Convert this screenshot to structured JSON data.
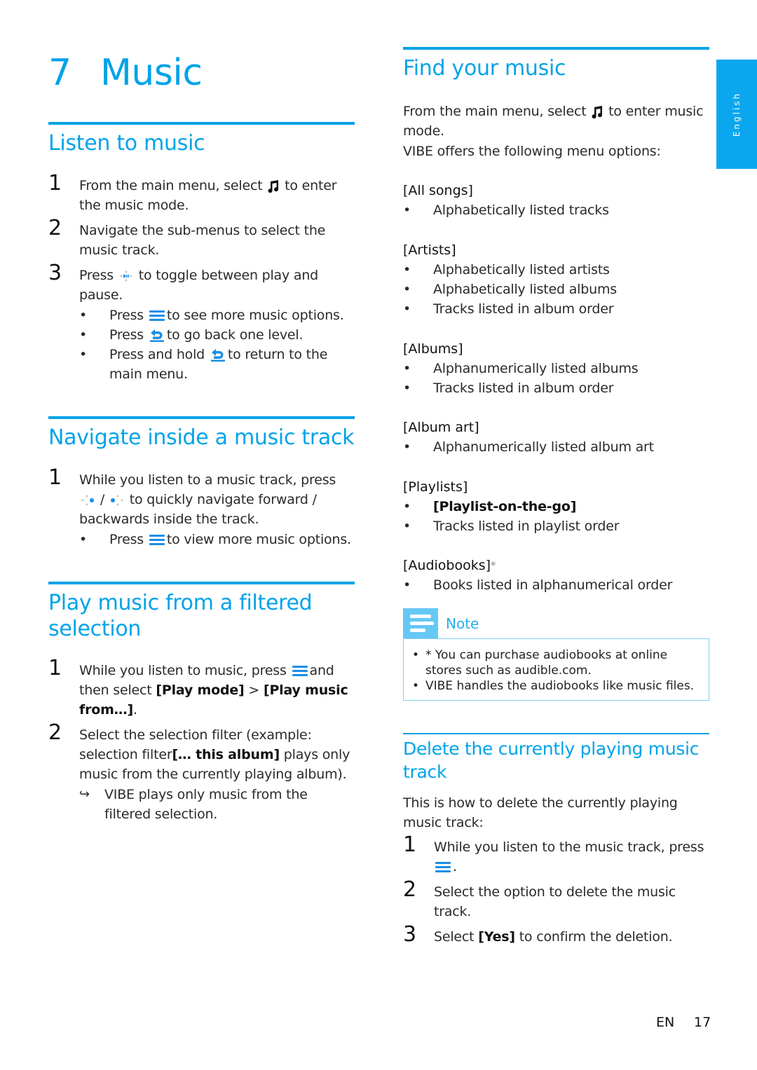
{
  "chapter": {
    "number": "7",
    "title": "Music"
  },
  "side_tab": {
    "label": "English"
  },
  "listen": {
    "title": "Listen to music",
    "steps": [
      {
        "num": "1",
        "before": "From the main menu, select",
        "icon": "music-note-icon",
        "after": "to enter the music mode."
      },
      {
        "num": "2",
        "text": "Navigate the sub-menus to select the music track."
      },
      {
        "num": "3",
        "before": "Press",
        "icon": "play-pause-icon",
        "after": "to toggle between play and pause."
      }
    ],
    "bullets": [
      {
        "before": "Press",
        "icon": "options-menu-icon",
        "after": "to see more music options."
      },
      {
        "before": "Press",
        "icon": "back-icon",
        "after": "to go back one level."
      },
      {
        "before": "Press and hold",
        "icon": "back-icon",
        "after": "to return to the main menu."
      }
    ]
  },
  "navigate": {
    "title": "Navigate inside a music track",
    "step": {
      "num": "1",
      "before": "While you listen to a music track, press",
      "separator": "/",
      "after": "to quickly navigate forward / backwards inside the track."
    },
    "bullet": {
      "before": "Press",
      "icon": "options-menu-icon",
      "after": "to view more music options."
    }
  },
  "filtered": {
    "title": "Play music from a filtered selection",
    "steps": [
      {
        "num": "1",
        "before": "While you listen to music, press",
        "after": "and then select",
        "opt1": "[Play mode]",
        "gt": ">",
        "opt2": "[Play music from…]",
        "end": "."
      },
      {
        "num": "2",
        "before": "Select the selection filter (example: selection filter",
        "opt": "[… this album]",
        "after": "plays only music from the currently playing album)."
      }
    ],
    "result": {
      "arrow": "↪",
      "text": "VIBE plays only music from the filtered selection."
    }
  },
  "find": {
    "title": "Find your music",
    "intro_before": "From the main menu, select",
    "intro_after": "to enter music mode.",
    "intro2": "VIBE offers the following menu options:",
    "menus": [
      {
        "head": "[All songs]",
        "items": [
          "Alphabetically listed tracks"
        ]
      },
      {
        "head": "[Artists]",
        "items": [
          "Alphabetically listed artists",
          "Alphabetically listed albums",
          "Tracks listed in album order"
        ]
      },
      {
        "head": "[Albums]",
        "items": [
          "Alphanumerically listed albums",
          "Tracks listed in album order"
        ]
      },
      {
        "head": "[Album art]",
        "items": [
          "Alphanumerically listed album art"
        ]
      },
      {
        "head": "[Playlists]",
        "items": [
          "[Playlist-on-the-go]",
          "Tracks listed in playlist order"
        ]
      },
      {
        "head": "[Audiobooks]",
        "asterisk": "*",
        "items": [
          "Books listed in alphanumerical order"
        ]
      }
    ]
  },
  "note": {
    "label": "Note",
    "items": [
      "* You can purchase audiobooks at online stores such as audible.com.",
      "VIBE handles the audiobooks like music files."
    ]
  },
  "delete": {
    "title": "Delete the currently playing music track",
    "intro": "This is how to delete the currently playing music track:",
    "steps": [
      {
        "num": "1",
        "before": "While you listen to the music track, press",
        "after": "."
      },
      {
        "num": "2",
        "text": "Select the option to delete the music track."
      },
      {
        "num": "3",
        "before": "Select",
        "opt": "[Yes]",
        "after": "to confirm the deletion."
      }
    ]
  },
  "footer": {
    "lang": "EN",
    "page": "17"
  },
  "colors": {
    "accent": "#00a3e8",
    "icon_blue": "#1a8ee6",
    "note_header": "#66c8f5",
    "note_border": "#7fd0f2"
  }
}
